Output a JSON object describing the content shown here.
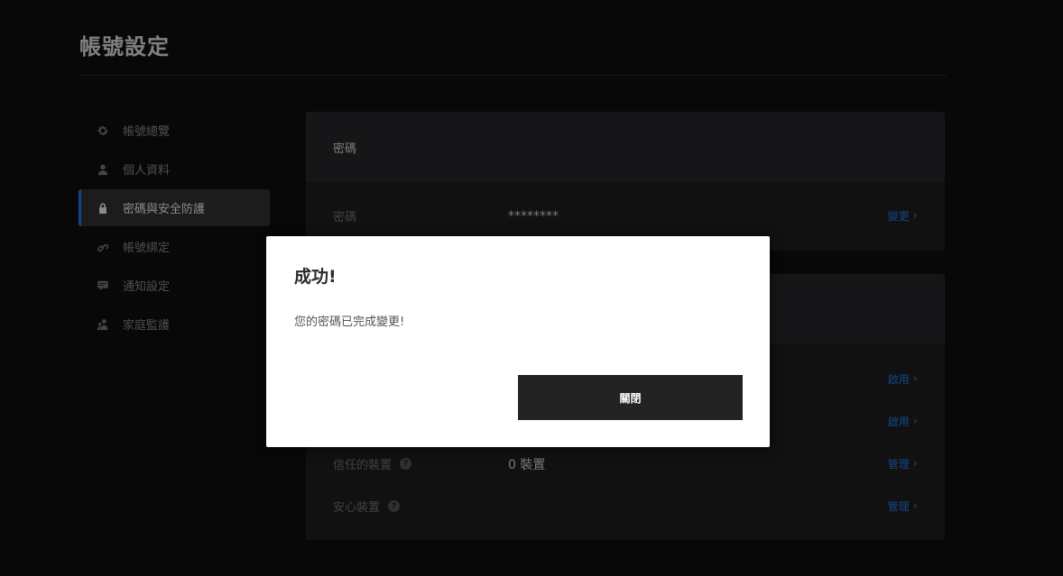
{
  "page": {
    "title": "帳號設定"
  },
  "sidebar": {
    "items": [
      {
        "label": "帳號總覽",
        "icon": "gear-icon",
        "active": false
      },
      {
        "label": "個人資料",
        "icon": "user-icon",
        "active": false
      },
      {
        "label": "密碼與安全防護",
        "icon": "lock-icon",
        "active": true
      },
      {
        "label": "帳號綁定",
        "icon": "link-icon",
        "active": false
      },
      {
        "label": "通知設定",
        "icon": "message-icon",
        "active": false
      },
      {
        "label": "家庭監護",
        "icon": "family-icon",
        "active": false
      }
    ]
  },
  "password_card": {
    "header": "密碼",
    "row": {
      "label": "密碼",
      "value": "********",
      "action": "變更"
    }
  },
  "security_card": {
    "rows": [
      {
        "label": "",
        "value": "",
        "action": "啟用"
      },
      {
        "label": "",
        "value": "",
        "action": "啟用"
      },
      {
        "label": "信任的裝置",
        "value": "0 裝置",
        "action": "管理",
        "help": "?"
      },
      {
        "label": "安心裝置",
        "value": "",
        "action": "管理",
        "help": "?"
      }
    ]
  },
  "modal": {
    "title": "成功!",
    "message": "您的密碼已完成變更!",
    "close_label": "關閉"
  },
  "colors": {
    "accent": "#1d6bd6",
    "link": "#1f6fd6",
    "background": "#0d0d0e",
    "card": "#1b1b1c"
  }
}
